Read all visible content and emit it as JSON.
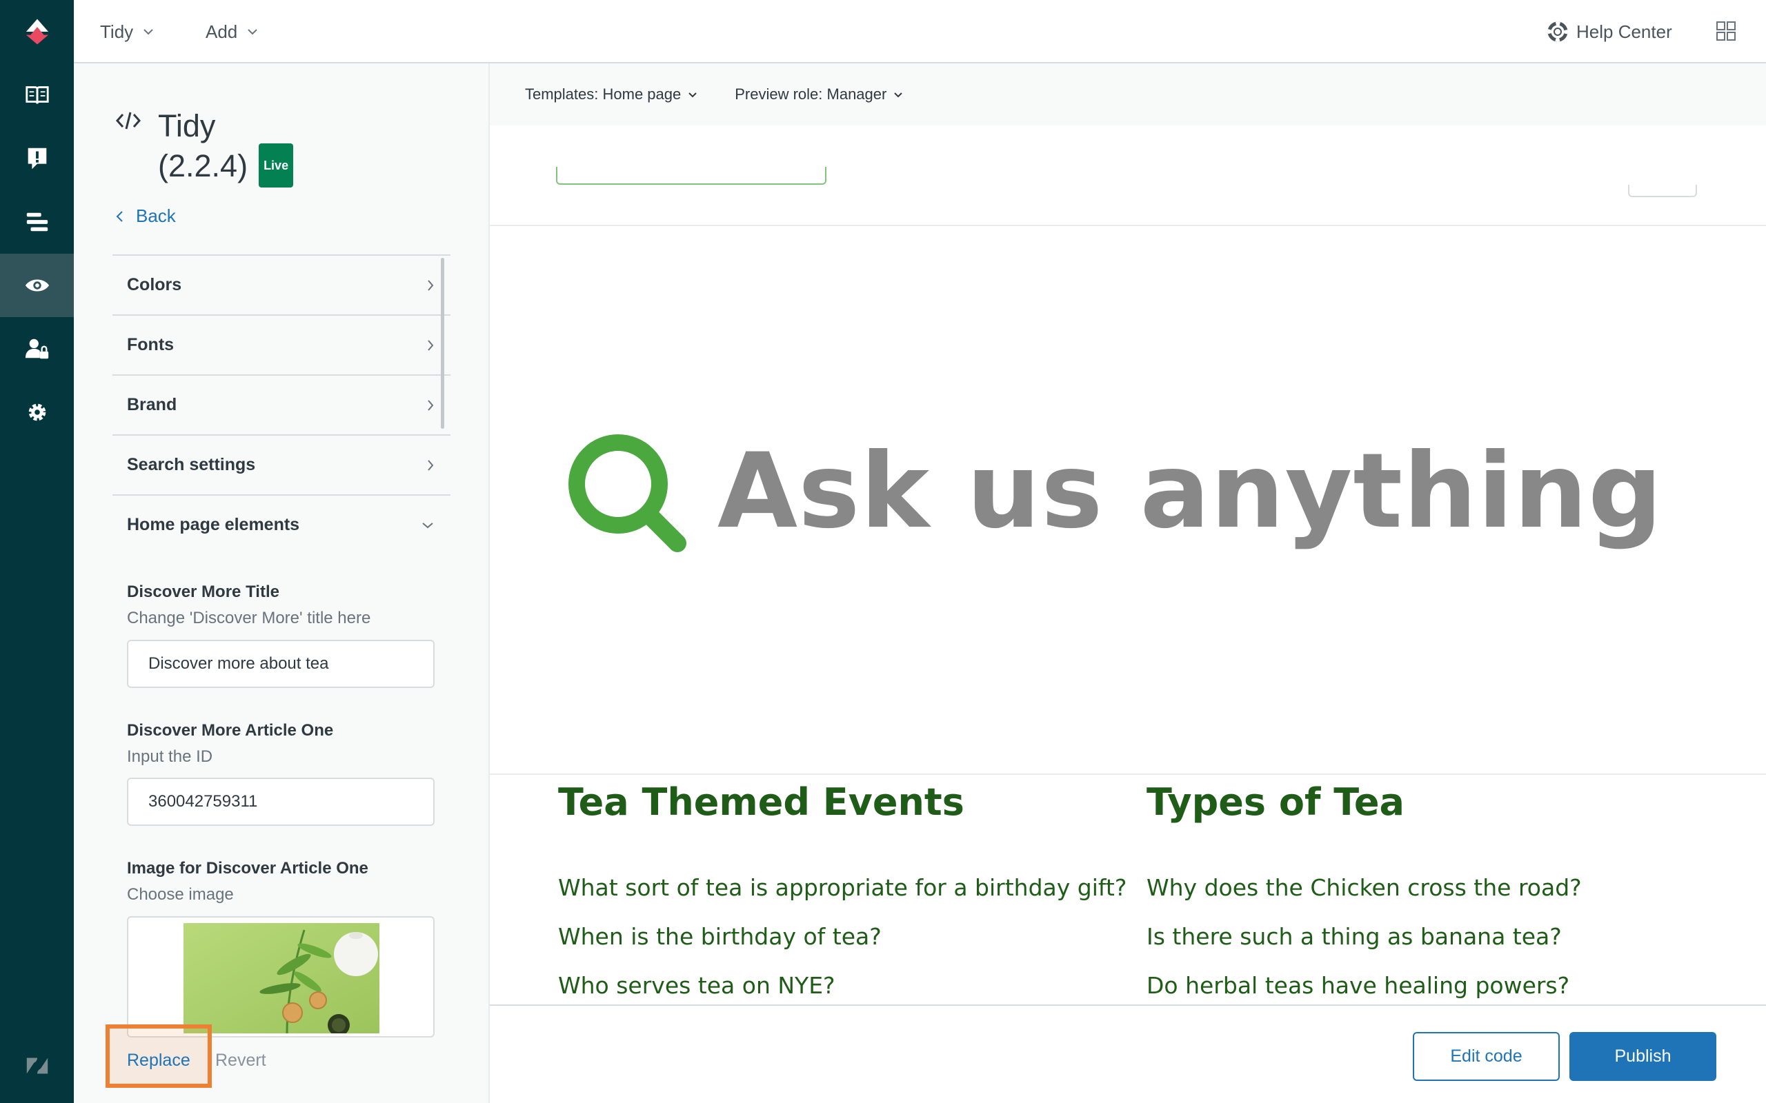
{
  "topbar": {
    "menu_tidy": "Tidy",
    "menu_add": "Add",
    "help_center": "Help Center"
  },
  "panel": {
    "theme_name": "Tidy",
    "theme_version": "(2.2.4)",
    "live_badge": "Live",
    "back": "Back",
    "accordions": [
      "Colors",
      "Fonts",
      "Brand",
      "Search settings",
      "Home page elements"
    ],
    "fields": {
      "discover_title_label": "Discover More Title",
      "discover_title_hint": "Change 'Discover More' title here",
      "discover_title_value": "Discover more about tea",
      "article_one_label": "Discover More Article One",
      "article_one_hint": "Input the ID",
      "article_one_value": "360042759311",
      "image_label": "Image for Discover Article One",
      "image_hint": "Choose image"
    },
    "replace": "Replace",
    "revert": "Revert"
  },
  "preview": {
    "templates": "Templates: Home page",
    "role": "Preview role: Manager",
    "hero_title": "Ask us anything",
    "columns": [
      {
        "title": "Tea Themed Events",
        "links": [
          "What sort of tea is appropriate for a birthday gift?",
          "When is the birthday of tea?",
          "Who serves tea on NYE?"
        ]
      },
      {
        "title": "Types of Tea",
        "links": [
          "Why does the Chicken cross the road?",
          "Is there such a thing as banana tea?",
          "Do herbal teas have healing powers?"
        ]
      }
    ]
  },
  "footer": {
    "edit_code": "Edit code",
    "publish": "Publish"
  },
  "colors": {
    "rail": "#03363d",
    "accent_blue": "#1f73b7",
    "heading_green": "#1e5c17",
    "search_green": "#4aa83f",
    "live_green": "#038153",
    "highlight_orange": "#ed8033"
  }
}
